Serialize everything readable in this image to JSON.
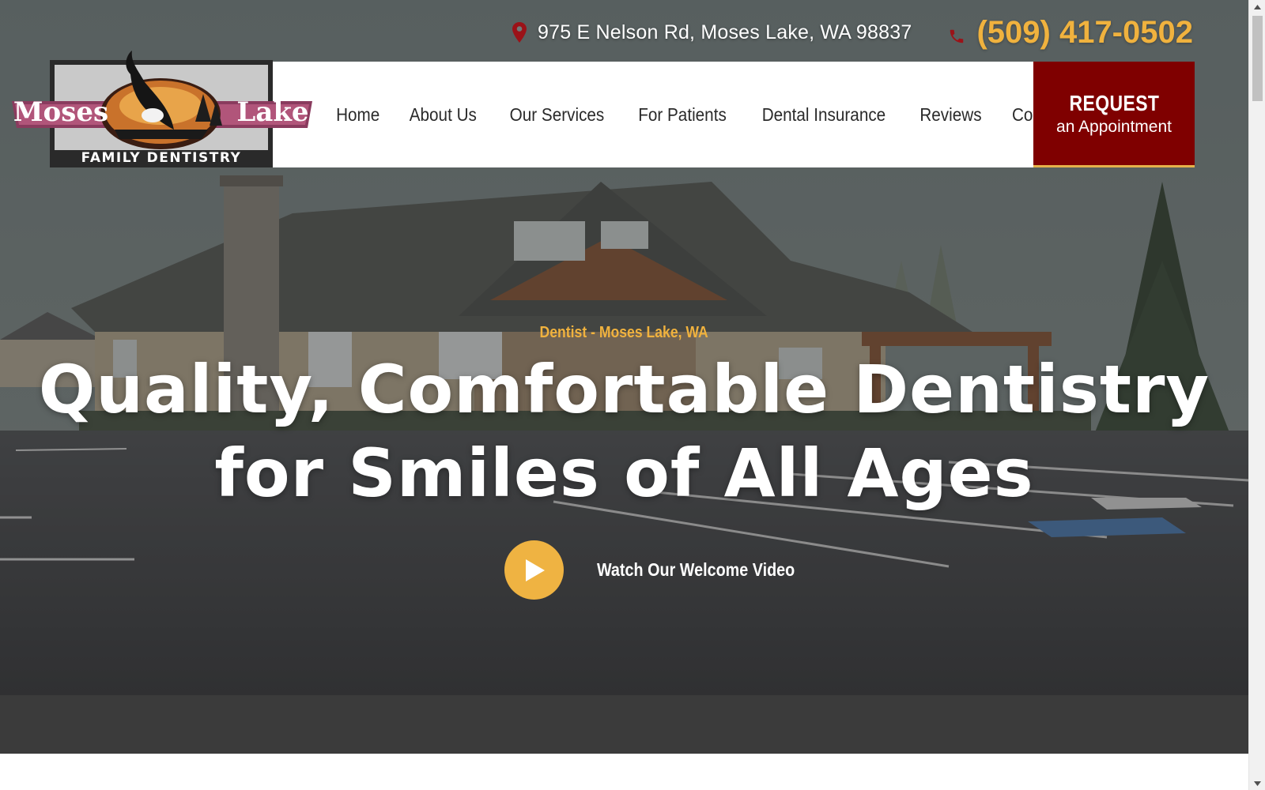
{
  "topbar": {
    "address": "975 E Nelson Rd, Moses Lake, WA 98837",
    "phone": "(509) 417-0502",
    "address_icon": "map-pin-icon",
    "phone_icon": "phone-icon"
  },
  "logo": {
    "line1_left": "Moses",
    "line1_right": "Lake",
    "line2": "FAMILY DENTISTRY"
  },
  "nav": {
    "items": [
      {
        "label": "Home"
      },
      {
        "label": "About Us"
      },
      {
        "label": "Our Services"
      },
      {
        "label": "For Patients"
      },
      {
        "label": "Dental Insurance"
      },
      {
        "label": "Reviews"
      },
      {
        "label": "Contact"
      }
    ],
    "request_line1": "REQUEST",
    "request_line2": "an Appointment"
  },
  "hero": {
    "eyebrow": "Dentist - Moses Lake, WA",
    "headline_line1": "Quality, Comfortable Dentistry",
    "headline_line2": "for Smiles of All Ages",
    "video_label": "Watch Our Welcome Video"
  },
  "colors": {
    "accent_gold": "#f0b23e",
    "brand_maroon": "#7f0000",
    "nav_text": "#2a2a2a",
    "dark_band": "#3b3b3b"
  }
}
